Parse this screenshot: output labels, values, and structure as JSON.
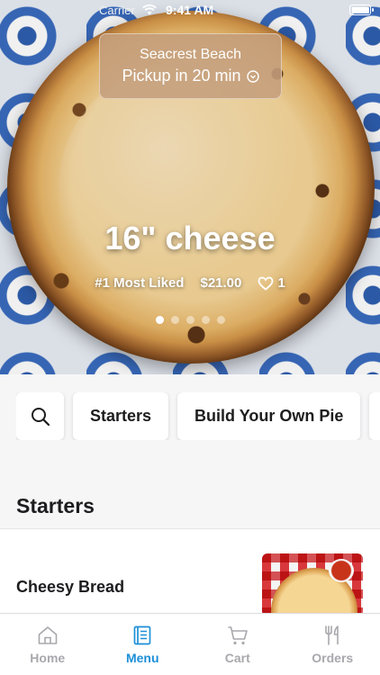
{
  "status_bar": {
    "carrier": "Carrier",
    "time": "9:41 AM"
  },
  "location": {
    "name": "Seacrest Beach",
    "pickup": "Pickup in 20 min"
  },
  "hero": {
    "title": "16\" cheese",
    "rank": "#1 Most Liked",
    "price": "$21.00",
    "likes": "1",
    "slides_total": 5,
    "slide_active": 1
  },
  "categories": [
    "Starters",
    "Build Your Own Pie"
  ],
  "section": {
    "title": "Starters"
  },
  "items": [
    {
      "name": "Cheesy Bread"
    }
  ],
  "tabbar": {
    "home": "Home",
    "menu": "Menu",
    "cart": "Cart",
    "orders": "Orders",
    "active": "Menu"
  },
  "colors": {
    "accent": "#1d8fd8",
    "inactive": "#a8a8ad"
  }
}
